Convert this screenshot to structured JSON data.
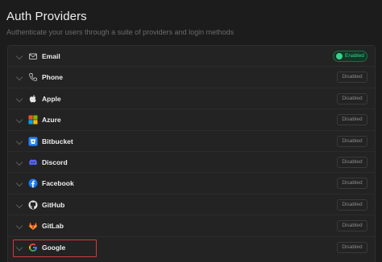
{
  "header": {
    "title": "Auth Providers",
    "subtitle": "Authenticate your users through a suite of providers and login methods"
  },
  "providers": [
    {
      "name": "Email",
      "status": "Enabled",
      "icon": "mail-icon"
    },
    {
      "name": "Phone",
      "status": "Disabled",
      "icon": "phone-icon"
    },
    {
      "name": "Apple",
      "status": "Disabled",
      "icon": "apple-icon"
    },
    {
      "name": "Azure",
      "status": "Disabled",
      "icon": "azure-icon"
    },
    {
      "name": "Bitbucket",
      "status": "Disabled",
      "icon": "bitbucket-icon"
    },
    {
      "name": "Discord",
      "status": "Disabled",
      "icon": "discord-icon"
    },
    {
      "name": "Facebook",
      "status": "Disabled",
      "icon": "facebook-icon"
    },
    {
      "name": "GitHub",
      "status": "Disabled",
      "icon": "github-icon"
    },
    {
      "name": "GitLab",
      "status": "Disabled",
      "icon": "gitlab-icon"
    },
    {
      "name": "Google",
      "status": "Disabled",
      "icon": "google-icon"
    }
  ],
  "highlighted_provider": "Google",
  "colors": {
    "background": "#1c1c1c",
    "enabled": "#3ecf8e",
    "highlight": "#d33a3a"
  }
}
